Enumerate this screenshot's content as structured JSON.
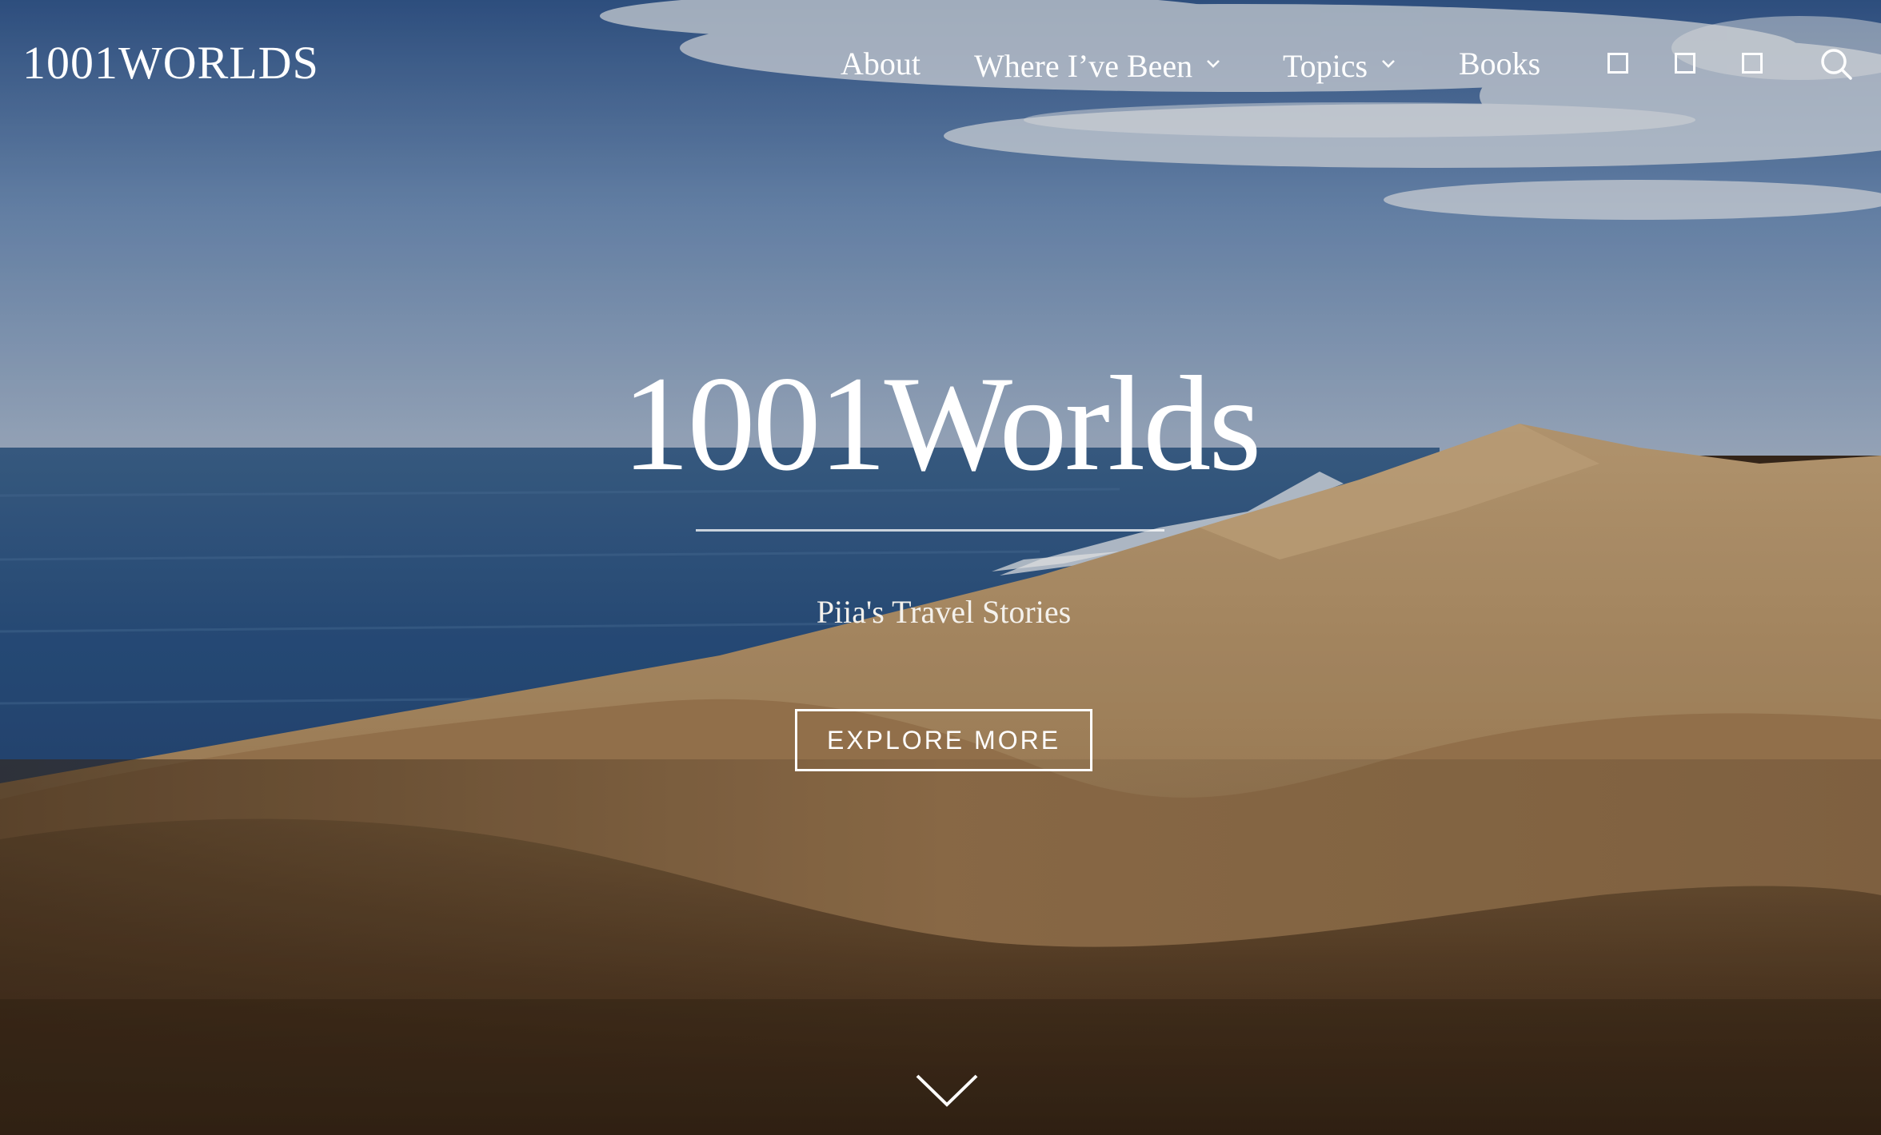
{
  "header": {
    "logo_text": "1001WORLDS",
    "nav": [
      {
        "label": "About",
        "has_dropdown": false
      },
      {
        "label": "Where I’ve Been",
        "has_dropdown": true
      },
      {
        "label": "Topics",
        "has_dropdown": true
      },
      {
        "label": "Books",
        "has_dropdown": false
      }
    ],
    "social_icons": [
      "square-icon",
      "square-icon",
      "square-icon"
    ],
    "search_icon": "search-icon"
  },
  "hero": {
    "title": "1001Worlds",
    "tagline": "Piia's Travel Stories",
    "cta_label": "EXPLORE MORE",
    "scroll_icon": "chevron-down-icon"
  },
  "colors": {
    "text": "#ffffff",
    "sky": "#4a6fa0",
    "sea": "#2a4f7c",
    "sand": "#b08a5c"
  }
}
